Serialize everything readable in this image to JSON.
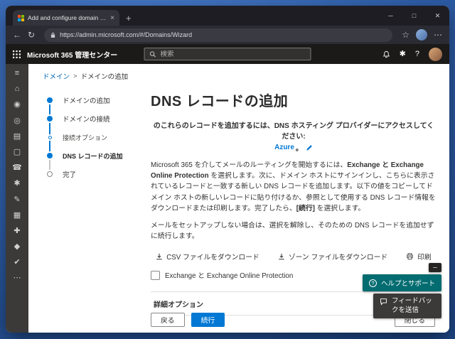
{
  "colors": {
    "accent": "#0078d4",
    "primary_button": "#0078d4",
    "help_button": "#036c70",
    "feedback_button": "#3b3a39",
    "app_header": "#1b1a19"
  },
  "browser": {
    "tab_title": "Add and configure domain - Mic",
    "tab_close_glyph": "×",
    "new_tab_glyph": "+",
    "back_glyph": "←",
    "refresh_glyph": "↻",
    "url": "https://admin.microsoft.com/#/Domains/Wizard",
    "star_glyph": "☆",
    "more_glyph": "⋯",
    "controls": {
      "minimize": "─",
      "maximize": "□",
      "close": "✕"
    }
  },
  "app_header": {
    "title": "Microsoft 365 管理センター",
    "search_placeholder": "検索",
    "settings_glyph": "✱",
    "help_glyph": "?"
  },
  "rail": {
    "icons": [
      {
        "name": "menu",
        "glyph": "≡"
      },
      {
        "name": "home",
        "glyph": "⌂"
      },
      {
        "name": "users",
        "glyph": "◉"
      },
      {
        "name": "groups",
        "glyph": "◎"
      },
      {
        "name": "billing",
        "glyph": "▤"
      },
      {
        "name": "devices",
        "glyph": "▢"
      },
      {
        "name": "support",
        "glyph": "☎"
      },
      {
        "name": "settings",
        "glyph": "✱"
      },
      {
        "name": "setup",
        "glyph": "✎"
      },
      {
        "name": "reports",
        "glyph": "▦"
      },
      {
        "name": "health",
        "glyph": "✚"
      },
      {
        "name": "security",
        "glyph": "◆"
      },
      {
        "name": "compliance",
        "glyph": "✔"
      },
      {
        "name": "more",
        "glyph": "⋯"
      }
    ]
  },
  "breadcrumb": {
    "domains": "ドメイン",
    "separator": ">",
    "current": "ドメインの追加"
  },
  "wizard": {
    "steps": [
      {
        "label": "ドメインの追加"
      },
      {
        "label": "ドメインの接続"
      },
      {
        "label": "接続オプション"
      },
      {
        "label": "DNS レコードの追加"
      },
      {
        "label": "完了"
      }
    ]
  },
  "main": {
    "title": "DNS レコードの追加",
    "provider": {
      "prefix": "のこれらのレコードを追加するには、DNS ホスティング プロバイダーにアクセスしてください: ",
      "name": "Azure",
      "suffix": "。"
    },
    "p1": {
      "seg1": "Microsoft 365 を介してメールのルーティングを開始するには、",
      "bold1": "Exchange と Exchange Online Protection",
      "seg2": " を選択します。次に、ドメイン ホストにサインインし、こちらに表示されているレコードと一致する新しい DNS レコードを追加します。以下の値をコピーしてドメイン ホストの新しいレコードに貼り付けるか、参照として使用する DNS レコード情報をダウンロードまたは印刷します。完了したら、",
      "bold2": "[続行]",
      "seg3": " を選択します。"
    },
    "p2": "メールをセットアップしない場合は、選択を解除し、そのための DNS レコードを追加せずに続行します。",
    "actions": [
      {
        "label": "CSV ファイルをダウンロード"
      },
      {
        "label": "ゾーン ファイルをダウンロード"
      },
      {
        "label": "印刷"
      }
    ],
    "checkbox_label": "Exchange と Exchange Online Protection",
    "advanced_label": "詳細オプション",
    "buttons": {
      "back": "戻る",
      "continue": "続行",
      "close": "閉じる"
    }
  },
  "floating": {
    "minimize_glyph": "─",
    "help": "ヘルプとサポート",
    "help_icon_glyph": "?",
    "feedback": "フィードバックを送信"
  }
}
